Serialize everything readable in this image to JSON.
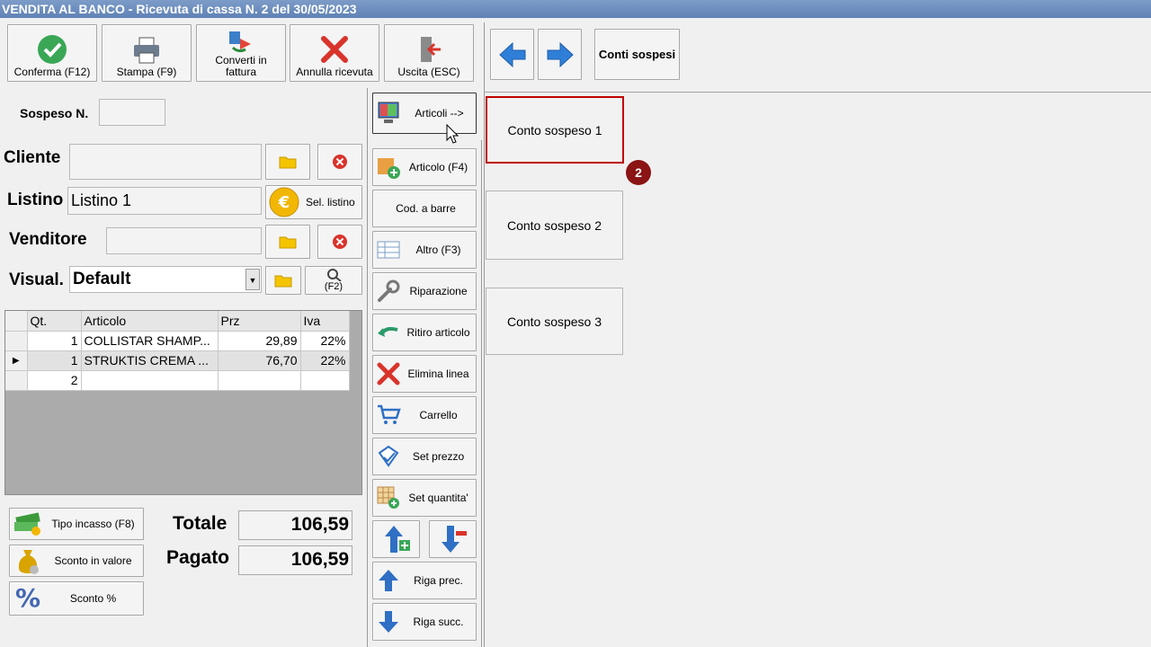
{
  "window": {
    "title": "VENDITA AL BANCO - Ricevuta di cassa N. 2 del 30/05/2023"
  },
  "toolbar": {
    "confirm": "Conferma (F12)",
    "print": "Stampa (F9)",
    "convert_line1": "Converti in",
    "convert_line2": "fattura",
    "cancel": "Annulla ricevuta",
    "exit": "Uscita (ESC)"
  },
  "form": {
    "sospeso_label": "Sospeso N.",
    "sospeso_value": "",
    "cliente_label": "Cliente",
    "cliente_value": "",
    "listino_label": "Listino",
    "listino_value": "Listino 1",
    "sel_listino": "Sel. listino",
    "venditore_label": "Venditore",
    "venditore_value": "",
    "visual_label": "Visual.",
    "visual_value": "Default",
    "f2_label": "(F2)"
  },
  "grid": {
    "headers": [
      "Qt.",
      "Articolo",
      "Prz",
      "Iva"
    ],
    "rows": [
      {
        "qty": "1",
        "article": "COLLISTAR SHAMP...",
        "price": "29,89",
        "vat": "22%"
      },
      {
        "qty": "1",
        "article": "STRUKTIS CREMA ...",
        "price": "76,70",
        "vat": "22%"
      },
      {
        "qty": "2",
        "article": "",
        "price": "",
        "vat": ""
      }
    ]
  },
  "bottom": {
    "tipo_incasso": "Tipo incasso (F8)",
    "sconto_valore": "Sconto in valore",
    "sconto_perc": "Sconto %",
    "totale_label": "Totale",
    "totale_value": "106,59",
    "pagato_label": "Pagato",
    "pagato_value": "106,59"
  },
  "middle": {
    "articoli": "Articoli -->",
    "articolo_f4": "Articolo (F4)",
    "cod_barre": "Cod. a barre",
    "altro": "Altro (F3)",
    "riparazione": "Riparazione",
    "ritiro": "Ritiro articolo",
    "elimina": "Elimina linea",
    "carrello": "Carrello",
    "set_prezzo": "Set prezzo",
    "set_quantita": "Set quantita'",
    "riga_prec": "Riga prec.",
    "riga_succ": "Riga succ."
  },
  "right": {
    "conti_sospesi": "Conti sospesi",
    "accounts": [
      "Conto sospeso 1",
      "Conto sospeso 2",
      "Conto sospeso 3"
    ],
    "step_badge": "2"
  },
  "colors": {
    "highlight": "#c00000",
    "badge": "#8b1414",
    "titlebar": "#6b8cbd"
  }
}
